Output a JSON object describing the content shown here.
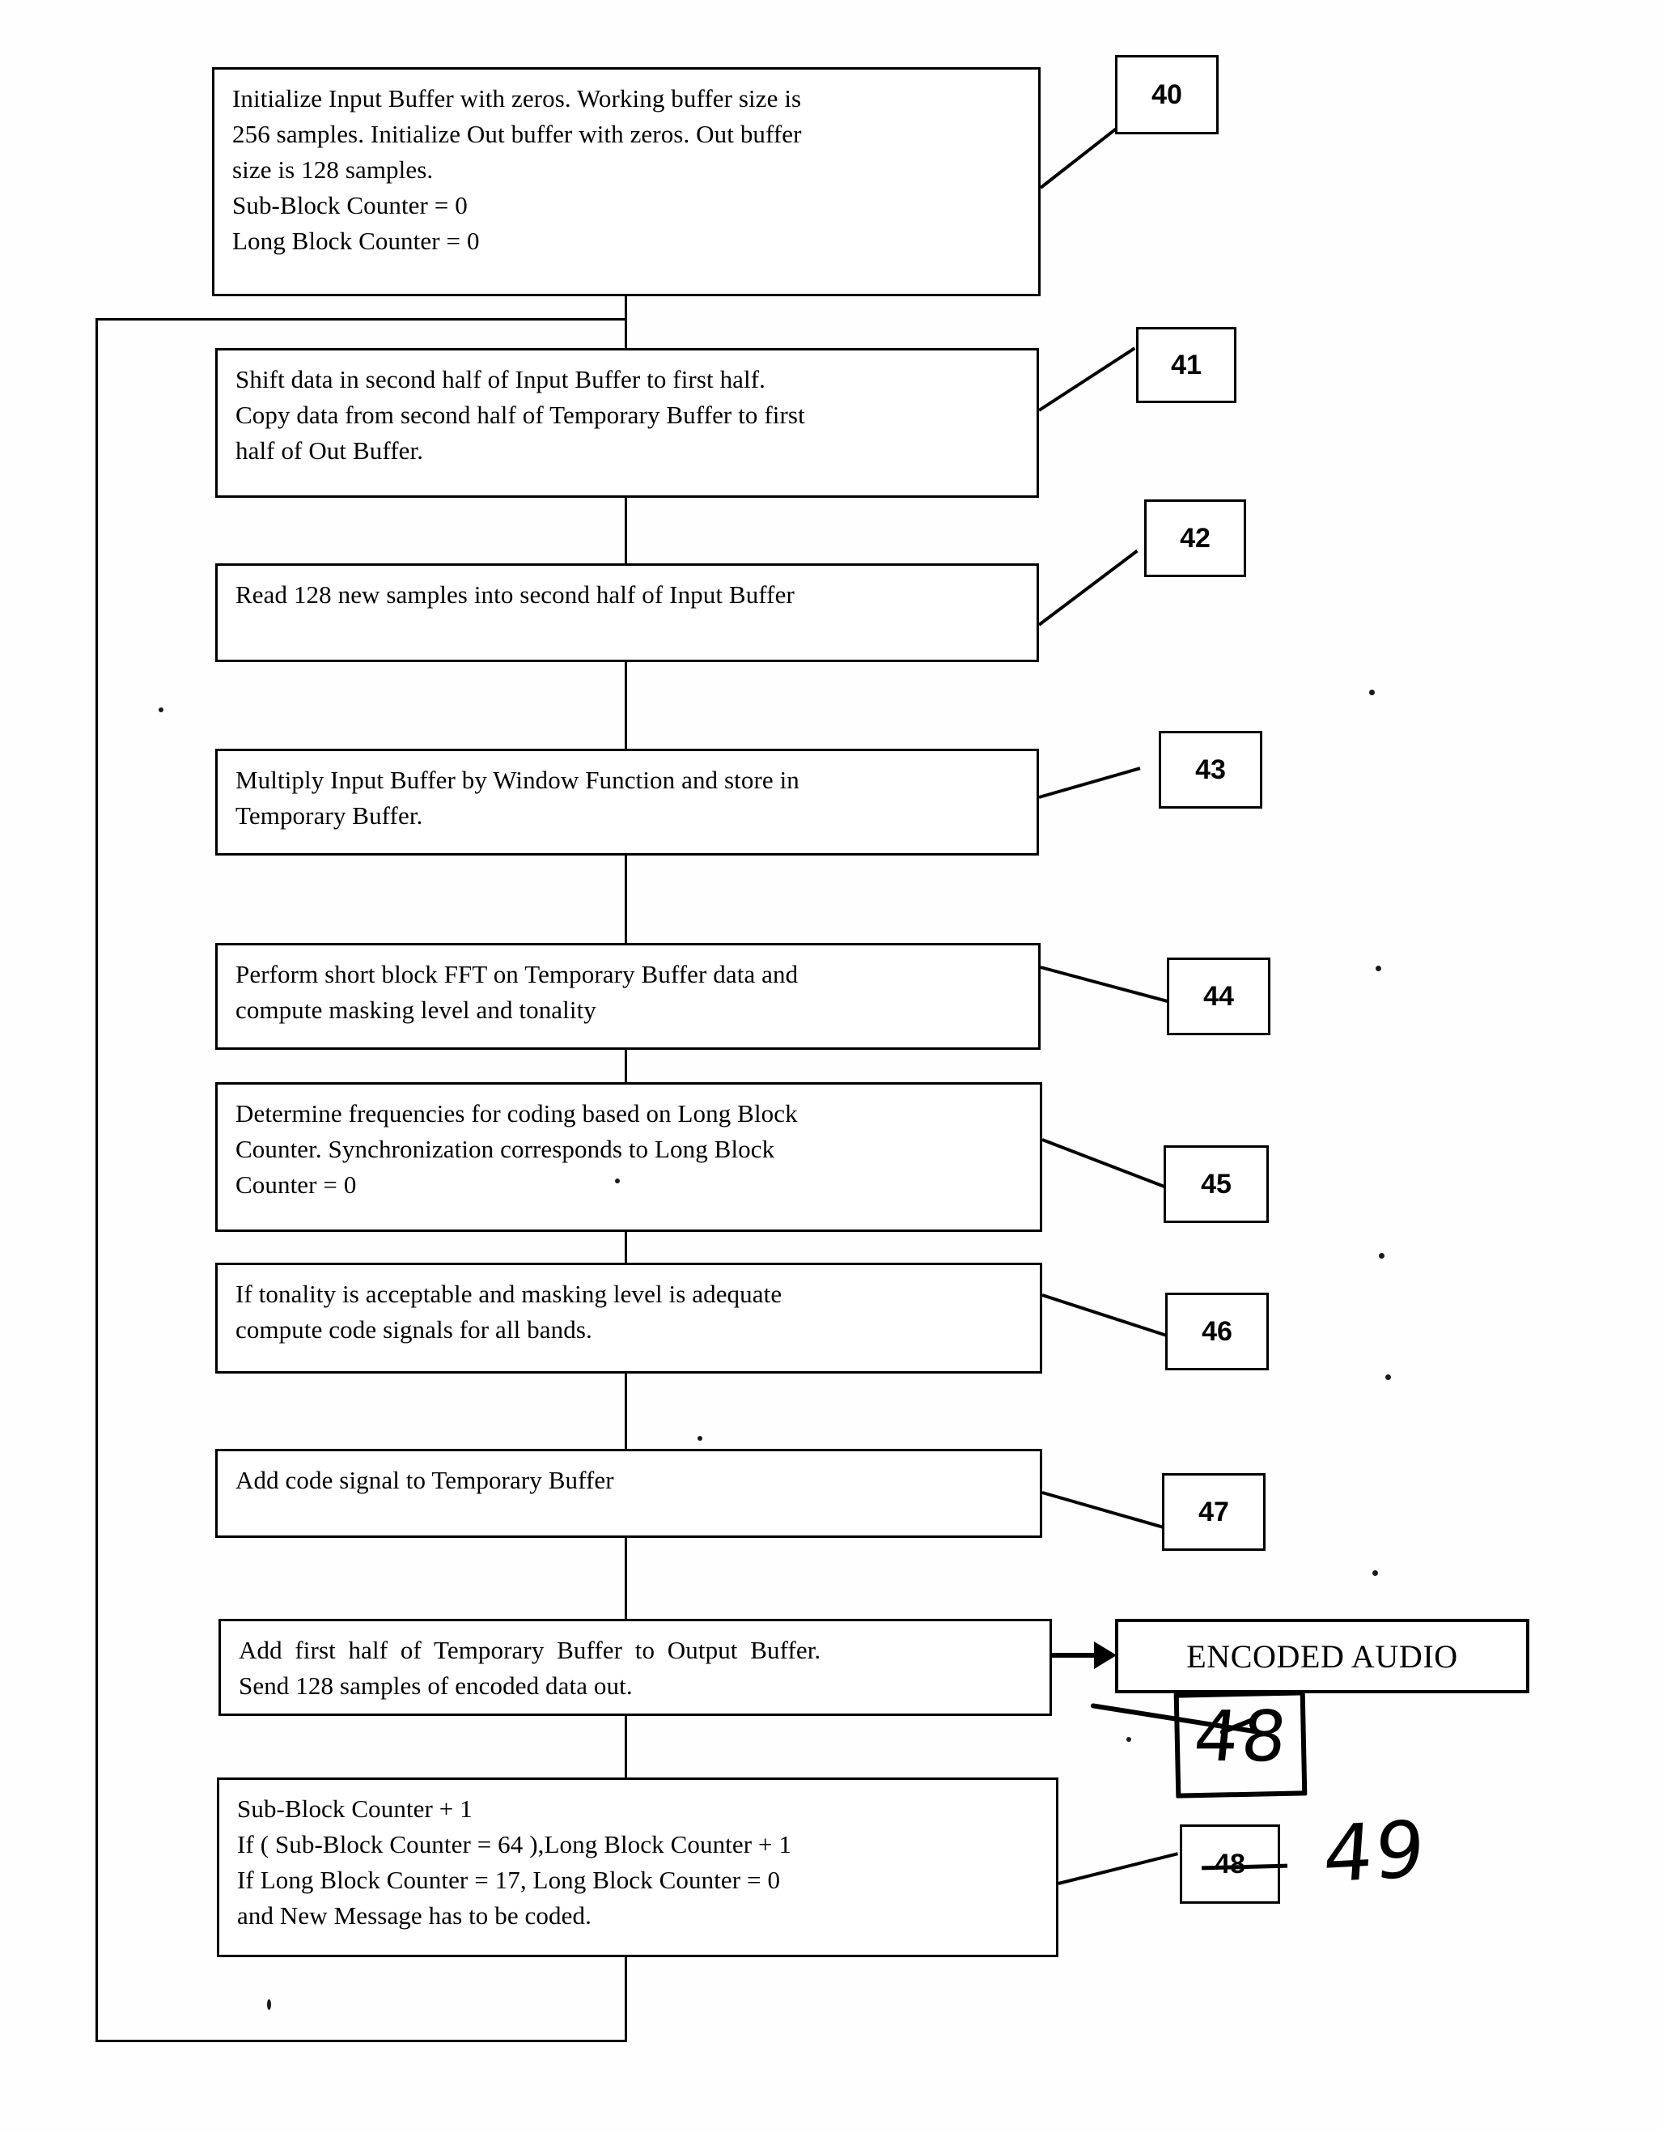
{
  "document": {
    "type": "patent-flowchart",
    "title": "Audio encoder processing flow"
  },
  "boxes": [
    {
      "id": "40",
      "name": "initialize-buffers",
      "lines": [
        "Initialize Input Buffer with zeros. Working buffer size is",
        "256 samples. Initialize Out buffer with zeros. Out buffer",
        "size is 128 samples.",
        "Sub-Block Counter = 0",
        "Long Block Counter = 0"
      ]
    },
    {
      "id": "41",
      "name": "shift-and-copy",
      "lines": [
        "Shift data in second half of Input Buffer to first half.",
        "Copy data from second half of Temporary Buffer to first",
        "half of Out Buffer."
      ]
    },
    {
      "id": "42",
      "name": "read-new-samples",
      "lines": [
        "Read 128 new samples into second half of Input Buffer"
      ]
    },
    {
      "id": "43",
      "name": "apply-window-function",
      "lines": [
        "Multiply Input Buffer by Window Function and store in",
        "Temporary Buffer."
      ]
    },
    {
      "id": "44",
      "name": "perform-fft",
      "lines": [
        "Perform short block FFT on Temporary Buffer data and",
        "compute masking level and tonality"
      ]
    },
    {
      "id": "45",
      "name": "determine-frequencies",
      "lines": [
        "Determine frequencies for coding based on Long Block",
        "Counter. Synchronization corresponds to Long Block",
        "Counter = 0"
      ]
    },
    {
      "id": "46",
      "name": "compute-code-signals",
      "lines": [
        "If tonality is acceptable and masking level is adequate",
        "compute code signals for all bands."
      ]
    },
    {
      "id": "47",
      "name": "add-code-signal",
      "lines": [
        "Add code signal to Temporary Buffer"
      ]
    },
    {
      "id": "48a",
      "name": "add-to-output-buffer",
      "lines": [
        "Add  first  half  of  Temporary  Buffer  to  Output  Buffer.",
        "Send 128 samples of encoded data out."
      ]
    },
    {
      "id": "48",
      "name": "increment-counters",
      "lines": [
        "Sub-Block Counter + 1",
        "If ( Sub-Block Counter = 64 ),Long Block Counter + 1",
        "If Long Block Counter = 17, Long Block Counter = 0",
        "and New Message has to be coded."
      ]
    }
  ],
  "terminal": {
    "name": "encoded-audio-output",
    "label": "ENCODED AUDIO"
  },
  "reference_numerals": {
    "n40": "40",
    "n41": "41",
    "n42": "42",
    "n43": "43",
    "n44": "44",
    "n45": "45",
    "n46": "46",
    "n47": "47",
    "n48_printed": "48"
  },
  "handwritten_annotations": {
    "corrected_numeral": "49",
    "added_numeral": "48",
    "note": "printed numeral 48 is struck through and replaced by handwritten 49; handwritten 48 boxed beneath ENCODED AUDIO"
  },
  "colors": {
    "ink": "#000000",
    "paper": "#ffffff"
  }
}
